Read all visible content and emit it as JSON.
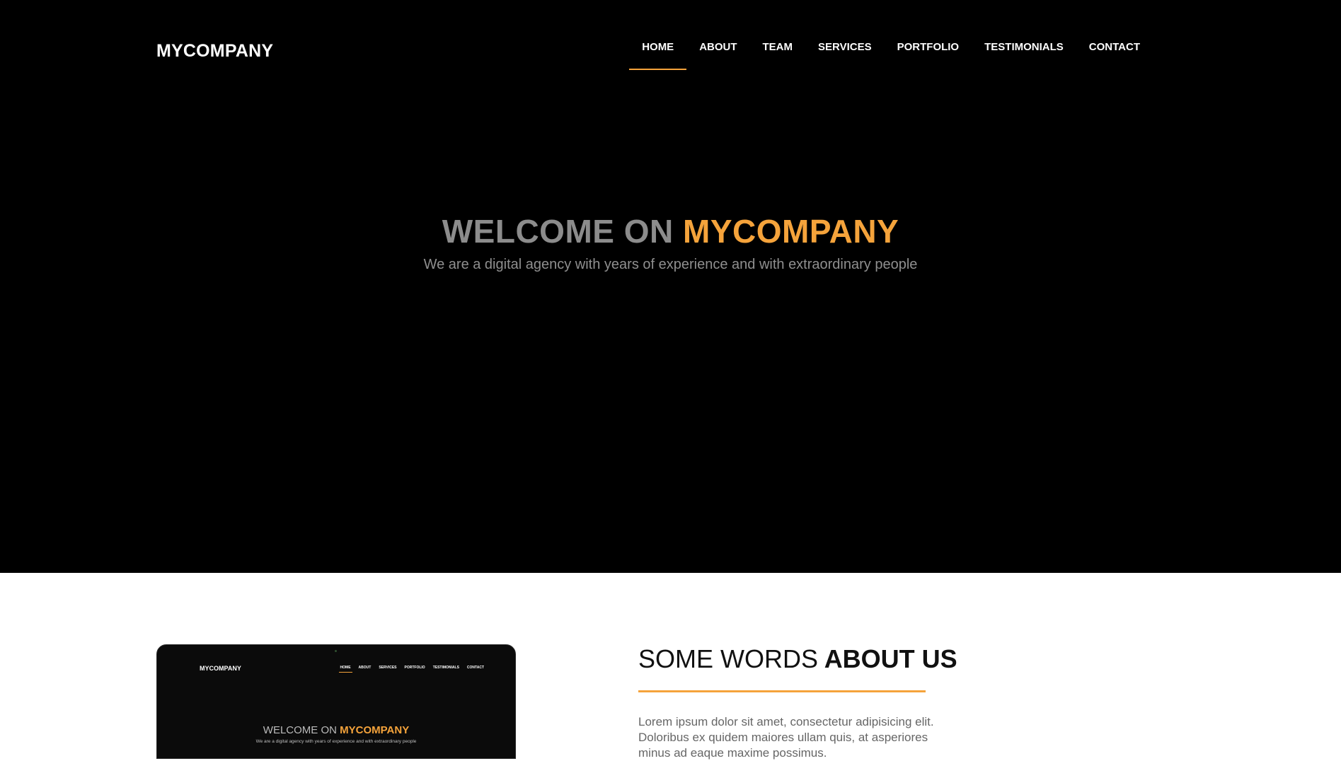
{
  "header": {
    "logo": "MYCOMPANY",
    "nav": [
      {
        "label": "HOME",
        "active": true
      },
      {
        "label": "ABOUT",
        "active": false
      },
      {
        "label": "TEAM",
        "active": false
      },
      {
        "label": "SERVICES",
        "active": false
      },
      {
        "label": "PORTFOLIO",
        "active": false
      },
      {
        "label": "TESTIMONIALS",
        "active": false
      },
      {
        "label": "CONTACT",
        "active": false
      }
    ]
  },
  "hero": {
    "title_prefix": "WELCOME ON",
    "title_accent": "MYCOMPANY",
    "subtitle": "We are a digital agency with years of experience and with extraordinary people"
  },
  "about": {
    "heading_light": "SOME WORDS",
    "heading_bold": "ABOUT US",
    "text": "Lorem ipsum dolor sit amet, consectetur adipisicing elit. Doloribus ex quidem maiores ullam quis, at asperiores minus ad eaque maxime possimus."
  },
  "mockup": {
    "logo": "MYCOMPANY",
    "nav": [
      "HOME",
      "ABOUT",
      "SERVICES",
      "PORTFOLIO",
      "TESTIMONIALS",
      "CONTACT"
    ],
    "title_prefix": "WELCOME ON",
    "title_accent": "MYCOMPANY",
    "subtitle": "We are a digital agency with years of experience and with extraordinary people"
  },
  "colors": {
    "accent": "#f5a33b",
    "hero_bg": "#000000",
    "muted_text": "#8c8c8c"
  }
}
